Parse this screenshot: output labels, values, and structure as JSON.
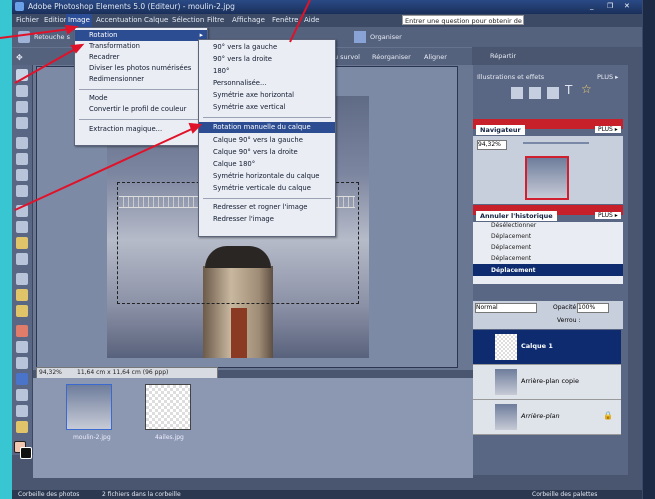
{
  "window": {
    "title": "Adobe Photoshop Elements 5.0 (Editeur) - moulin-2.jpg",
    "controls": [
      "_",
      "❐",
      "✕"
    ]
  },
  "menubar": {
    "items": [
      "Fichier",
      "Edition",
      "Image",
      "Accentuation",
      "Calque",
      "Sélection",
      "Filtre",
      "Affichage",
      "Fenêtre",
      "Aide"
    ],
    "help_placeholder": "Entrer une question pour obtenir de l'aide"
  },
  "toolbar": {
    "retouche": "Retouche s",
    "organiser": "Organiser",
    "survol": "au survol",
    "reorganiser": "Réorganiser",
    "aligner": "Aligner",
    "repartir": "Répartir"
  },
  "image_menu": {
    "items": [
      {
        "label": "Rotation",
        "submenu": true,
        "highlight": true
      },
      {
        "label": "Transformation",
        "submenu": true
      },
      {
        "label": "Recadrer"
      },
      {
        "label": "Diviser les photos numérisées"
      },
      {
        "label": "Redimensionner",
        "submenu": true
      },
      {
        "label": "Mode",
        "submenu": true
      },
      {
        "label": "Convertir le profil de couleur",
        "submenu": true
      },
      {
        "label": "Extraction magique..."
      }
    ]
  },
  "rotation_menu": {
    "items": [
      "90° vers la gauche",
      "90° vers la droite",
      "180°",
      "Personnalisée...",
      "Symétrie axe horizontal",
      "Symétrie axe vertical",
      "Rotation manuelle du calque",
      "Calque 90° vers la gauche",
      "Calque 90° vers la droite",
      "Calque 180°",
      "Symétrie horizontale du calque",
      "Symétrie verticale du calque",
      "Redresser et rogner l'image",
      "Redresser l'image"
    ],
    "highlight_index": 6
  },
  "document": {
    "zoom": "94,32%",
    "size": "11,64 cm x 11,64 cm (96 ppp)"
  },
  "bin": {
    "thumbs": [
      {
        "label": "moulin-2.jpg"
      },
      {
        "label": "4ailes.jpg"
      }
    ]
  },
  "palettes": {
    "effects_title": "Illustrations et effets",
    "more": "PLUS ▸",
    "navigator": {
      "title": "Navigateur",
      "zoom": "94,32%",
      "plus": "PLUS ▸"
    },
    "history": {
      "title": "Annuler l'historique",
      "plus": "PLUS ▸",
      "rows": [
        "Désélectionner",
        "Déplacement",
        "Déplacement",
        "Déplacement",
        "Déplacement"
      ],
      "selected_index": 4
    },
    "layers": {
      "mode": "Normal",
      "opacity_label": "Opacité :",
      "opacity": "100%",
      "lock_label": "Verrou :",
      "rows": [
        {
          "name": "Calque 1",
          "selected": true
        },
        {
          "name": "Arrière-plan copie",
          "selected": false
        },
        {
          "name": "Arrière-plan",
          "selected": false
        }
      ]
    }
  },
  "statusbar": {
    "left": "Corbeille des photos",
    "count": "2 fichiers dans la corbeille",
    "right": "Corbeille des palettes"
  },
  "colors": {
    "accent": "#2c4d92",
    "arrow": "#e0122a",
    "palette_header": "#c7202b"
  }
}
